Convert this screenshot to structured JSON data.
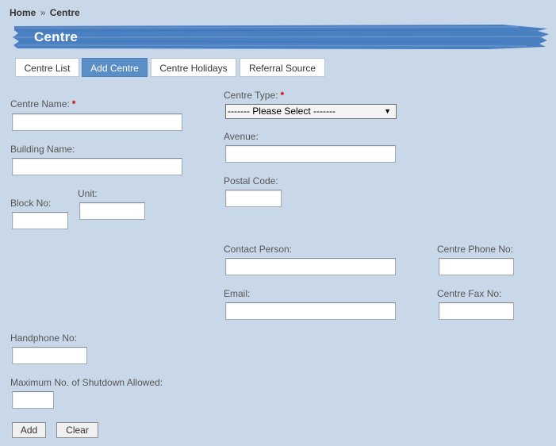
{
  "breadcrumb": {
    "home": "Home",
    "separator": "»",
    "current": "Centre"
  },
  "page_title": "Centre",
  "tabs": [
    {
      "label": "Centre List",
      "active": false
    },
    {
      "label": "Add Centre",
      "active": true
    },
    {
      "label": "Centre Holidays",
      "active": false
    },
    {
      "label": "Referral Source",
      "active": false
    }
  ],
  "required_mark": "*",
  "fields": {
    "centre_name": {
      "label": "Centre Name:",
      "value": ""
    },
    "centre_type": {
      "label": "Centre Type:",
      "selected": "------- Please Select -------"
    },
    "building_name": {
      "label": "Building Name:",
      "value": ""
    },
    "avenue": {
      "label": "Avenue:",
      "value": ""
    },
    "block_no": {
      "label": "Block No:",
      "value": ""
    },
    "unit": {
      "label": "Unit:",
      "value": ""
    },
    "postal_code": {
      "label": "Postal Code:",
      "value": ""
    },
    "contact_person": {
      "label": "Contact Person:",
      "value": ""
    },
    "centre_phone": {
      "label": "Centre Phone No:",
      "value": ""
    },
    "email": {
      "label": "Email:",
      "value": ""
    },
    "centre_fax": {
      "label": "Centre Fax No:",
      "value": ""
    },
    "handphone": {
      "label": "Handphone No:",
      "value": ""
    },
    "max_shutdown": {
      "label": "Maximum No. of Shutdown Allowed:",
      "value": ""
    }
  },
  "buttons": {
    "add": "Add",
    "clear": "Clear"
  },
  "colors": {
    "background": "#c9d8e8",
    "banner": "#4a7fc1",
    "tab_active": "#5b8dc7",
    "required": "#d00000"
  }
}
